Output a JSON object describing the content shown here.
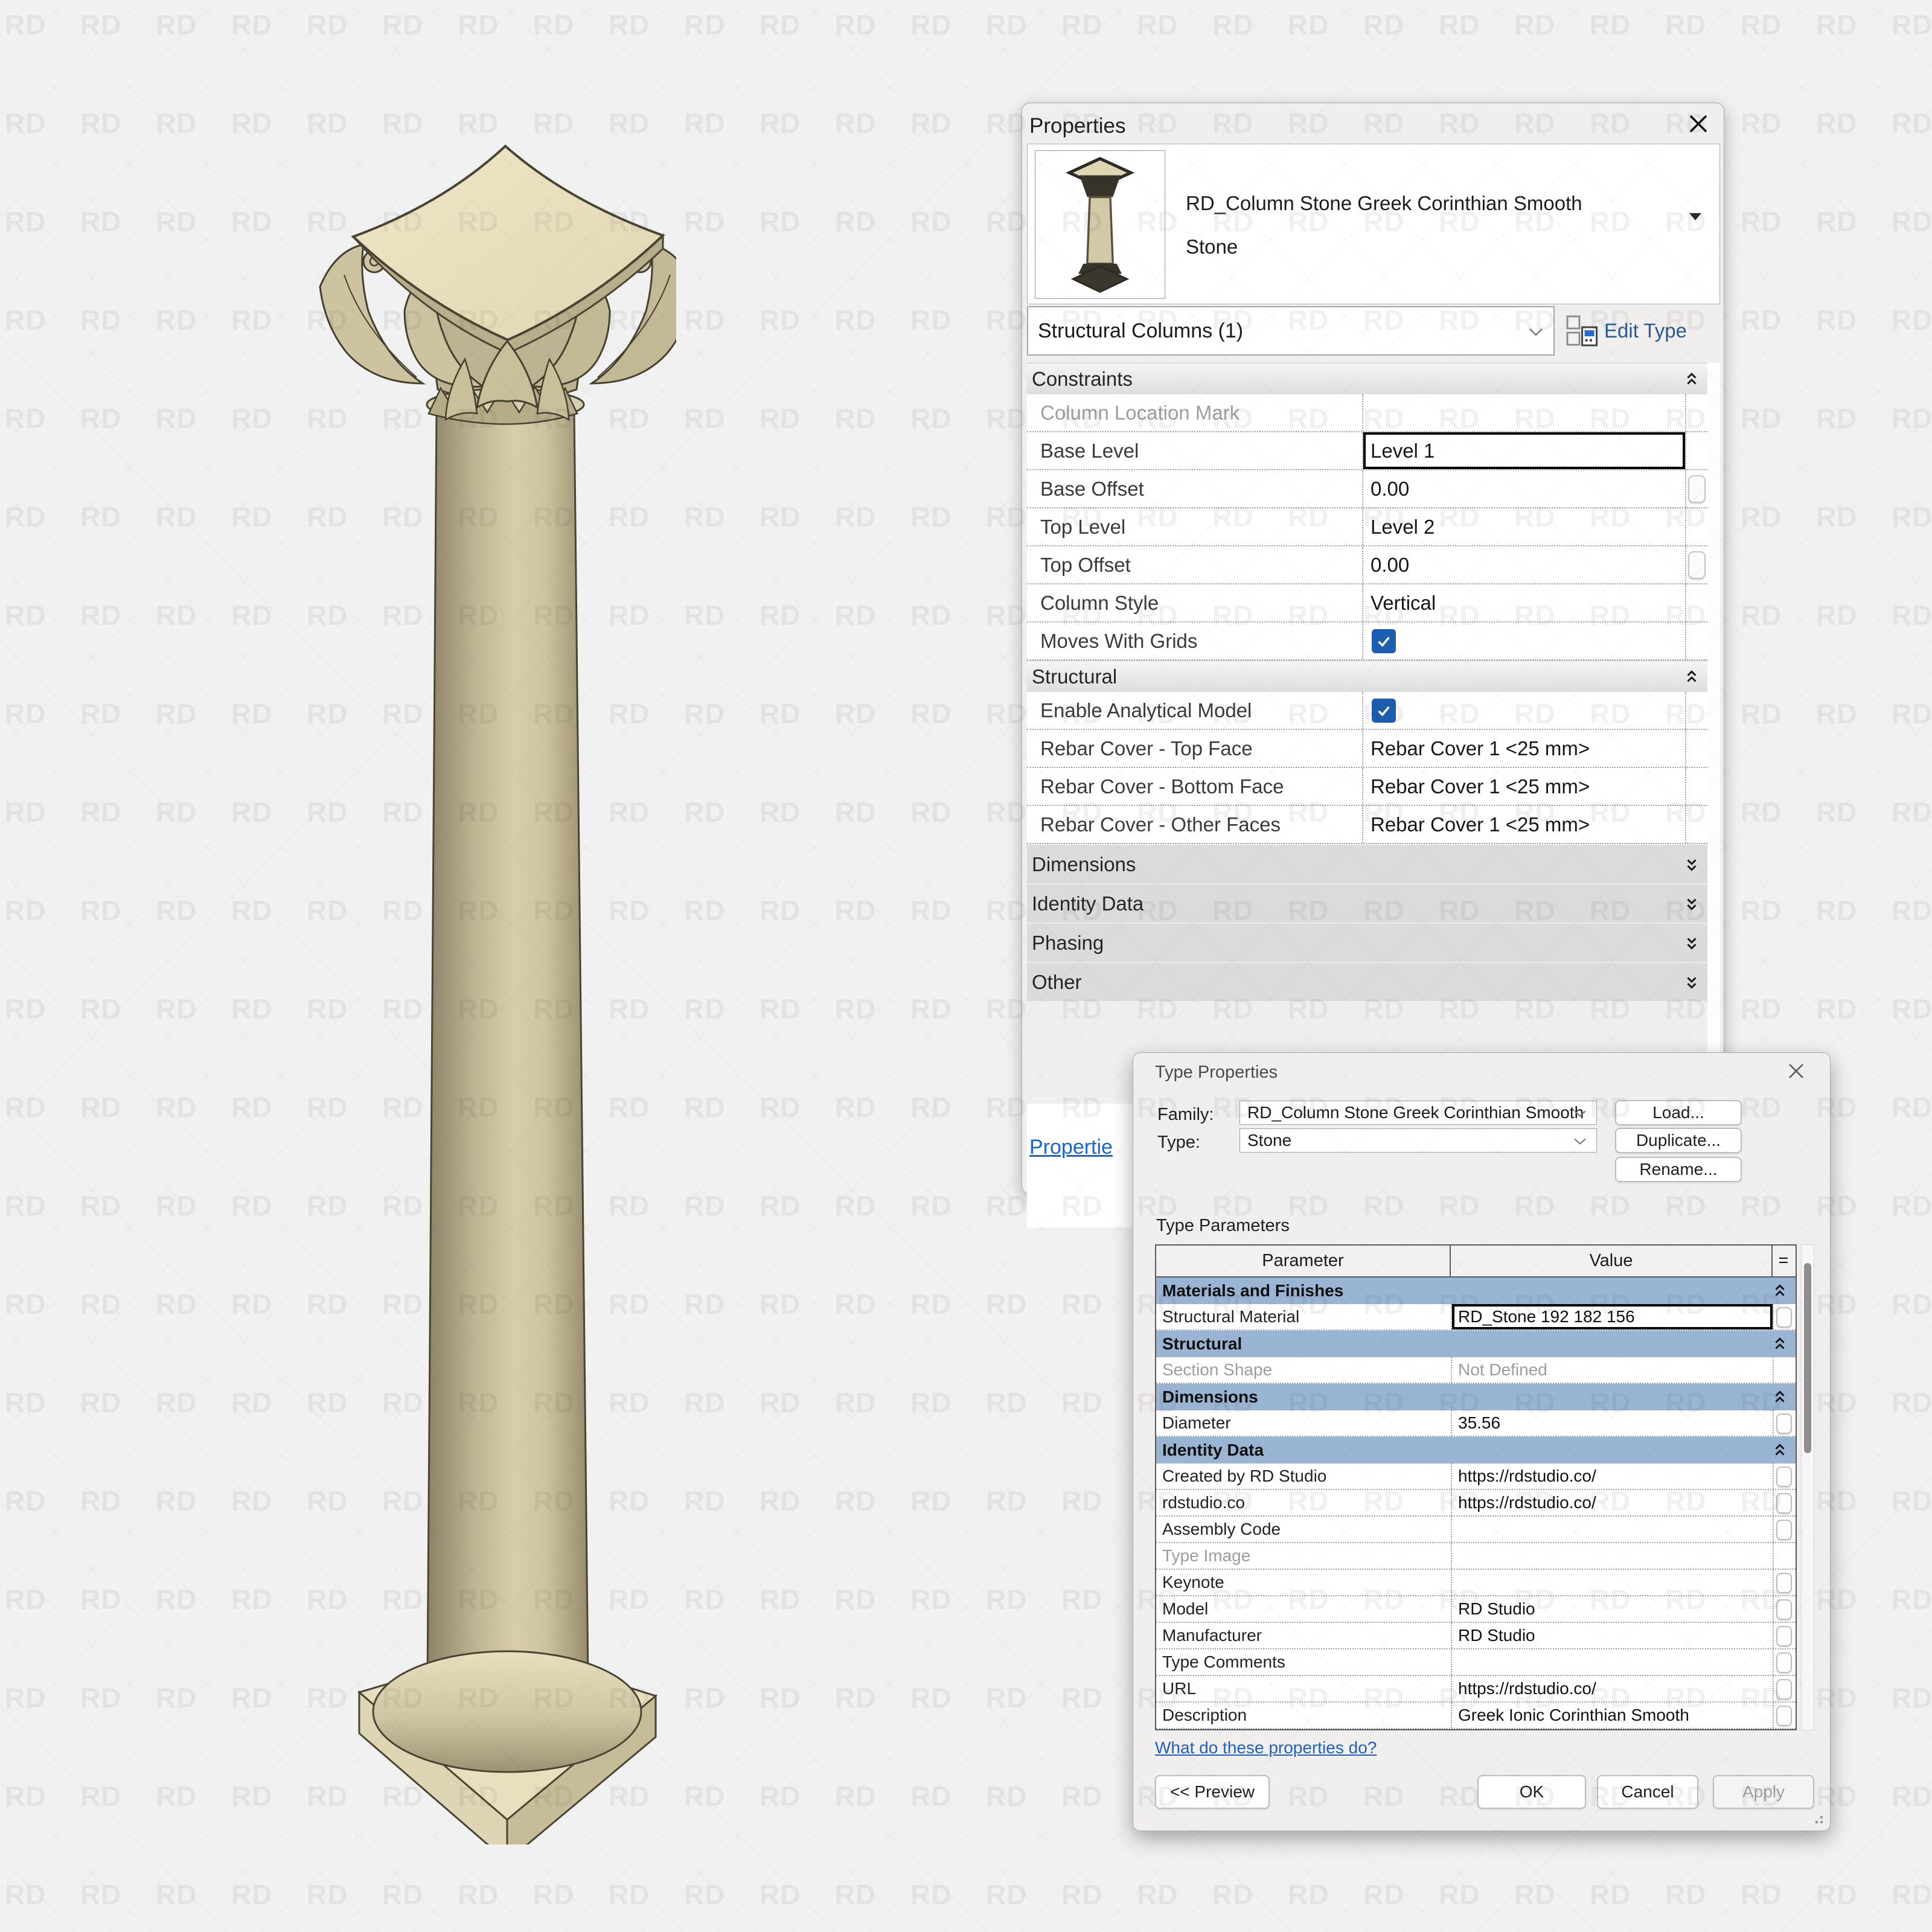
{
  "watermark": {
    "text": "RD"
  },
  "colors": {
    "checkbox_blue": "#1c5fb2",
    "group_header_blue": "#9ab4d4",
    "link_blue": "#1a66cc",
    "edit_type_text": "#2b5a92",
    "stone_light": "#e9dfc0",
    "stone_mid": "#cdc3a0",
    "stone_dark": "#a89d7c"
  },
  "properties_panel": {
    "title": "Properties",
    "type_selector": {
      "line1": "RD_Column Stone Greek Corinthian Smooth",
      "line2": "Stone"
    },
    "category_selector": "Structural Columns (1)",
    "edit_type_label": "Edit Type",
    "rows": [
      {
        "kind": "header",
        "label": "Constraints"
      },
      {
        "kind": "row",
        "label": "Column Location Mark",
        "value": "",
        "disabled": true
      },
      {
        "kind": "row",
        "label": "Base Level",
        "value": "Level 1",
        "selected": true
      },
      {
        "kind": "row",
        "label": "Base Offset",
        "value": "0.00",
        "sideButton": true
      },
      {
        "kind": "row",
        "label": "Top Level",
        "value": "Level 2"
      },
      {
        "kind": "row",
        "label": "Top Offset",
        "value": "0.00",
        "sideButton": true
      },
      {
        "kind": "row",
        "label": "Column Style",
        "value": "Vertical"
      },
      {
        "kind": "row",
        "label": "Moves With Grids",
        "checkbox": true,
        "checked": true
      },
      {
        "kind": "header",
        "label": "Structural"
      },
      {
        "kind": "row",
        "label": "Enable Analytical Model",
        "checkbox": true,
        "checked": true
      },
      {
        "kind": "row",
        "label": "Rebar Cover - Top Face",
        "value": "Rebar Cover 1 <25 mm>"
      },
      {
        "kind": "row",
        "label": "Rebar Cover - Bottom Face",
        "value": "Rebar Cover 1 <25 mm>"
      },
      {
        "kind": "row",
        "label": "Rebar Cover - Other Faces",
        "value": "Rebar Cover 1 <25 mm>"
      },
      {
        "kind": "collapsed",
        "label": "Dimensions"
      },
      {
        "kind": "collapsed",
        "label": "Identity Data"
      },
      {
        "kind": "collapsed",
        "label": "Phasing"
      },
      {
        "kind": "collapsed",
        "label": "Other"
      }
    ],
    "footer_link": "Propertie"
  },
  "type_properties": {
    "title": "Type Properties",
    "family_label": "Family:",
    "family_value": "RD_Column Stone Greek Corinthian Smooth",
    "type_label": "Type:",
    "type_value": "Stone",
    "load_button": "Load...",
    "duplicate_button": "Duplicate...",
    "rename_button": "Rename...",
    "type_parameters_label": "Type Parameters",
    "table": {
      "param_header": "Parameter",
      "value_header": "Value",
      "eq_header": "=",
      "rows": [
        {
          "kind": "group",
          "label": "Materials and Finishes"
        },
        {
          "kind": "row",
          "param": "Structural Material",
          "value": "RD_Stone 192 182 156",
          "selected": true,
          "button": true
        },
        {
          "kind": "group",
          "label": "Structural"
        },
        {
          "kind": "row",
          "param": "Section Shape",
          "value": "Not Defined",
          "disabled": true
        },
        {
          "kind": "group",
          "label": "Dimensions"
        },
        {
          "kind": "row",
          "param": "Diameter",
          "value": "35.56",
          "button": true
        },
        {
          "kind": "group",
          "label": "Identity Data"
        },
        {
          "kind": "row",
          "param": "Created by RD Studio",
          "value": "https://rdstudio.co/",
          "button": true
        },
        {
          "kind": "row",
          "param": "rdstudio.co",
          "value": "https://rdstudio.co/",
          "button": true
        },
        {
          "kind": "row",
          "param": "Assembly Code",
          "value": "",
          "button": true
        },
        {
          "kind": "row",
          "param": "Type Image",
          "value": "",
          "disabled": true
        },
        {
          "kind": "row",
          "param": "Keynote",
          "value": "",
          "button": true
        },
        {
          "kind": "row",
          "param": "Model",
          "value": "RD Studio",
          "button": true
        },
        {
          "kind": "row",
          "param": "Manufacturer",
          "value": "RD Studio",
          "button": true
        },
        {
          "kind": "row",
          "param": "Type Comments",
          "value": "",
          "button": true
        },
        {
          "kind": "row",
          "param": "URL",
          "value": "https://rdstudio.co/",
          "button": true
        },
        {
          "kind": "row",
          "param": "Description",
          "value": "Greek Ionic Corinthian Smooth",
          "button": true
        }
      ]
    },
    "help_link": "What do these properties do?",
    "preview_button": "<< Preview",
    "ok_button": "OK",
    "cancel_button": "Cancel",
    "apply_button": "Apply"
  }
}
